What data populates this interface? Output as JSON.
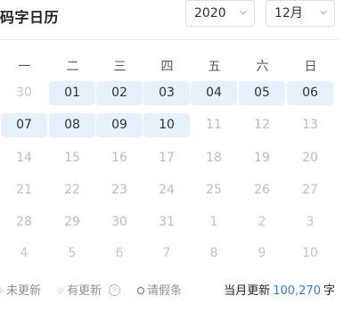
{
  "header": {
    "title": "码字日历",
    "year_value": "2020",
    "month_value": "12月"
  },
  "weekdays": [
    "一",
    "二",
    "三",
    "四",
    "五",
    "六",
    "日"
  ],
  "calendar": {
    "weeks": [
      [
        {
          "day": "30",
          "state": "other"
        },
        {
          "day": "01",
          "state": "updated"
        },
        {
          "day": "02",
          "state": "updated"
        },
        {
          "day": "03",
          "state": "updated"
        },
        {
          "day": "04",
          "state": "updated"
        },
        {
          "day": "05",
          "state": "updated"
        },
        {
          "day": "06",
          "state": "updated"
        }
      ],
      [
        {
          "day": "07",
          "state": "updated"
        },
        {
          "day": "08",
          "state": "updated"
        },
        {
          "day": "09",
          "state": "updated"
        },
        {
          "day": "10",
          "state": "updated"
        },
        {
          "day": "11",
          "state": "normal"
        },
        {
          "day": "12",
          "state": "normal"
        },
        {
          "day": "13",
          "state": "normal"
        }
      ],
      [
        {
          "day": "14",
          "state": "normal"
        },
        {
          "day": "15",
          "state": "normal"
        },
        {
          "day": "16",
          "state": "normal"
        },
        {
          "day": "17",
          "state": "normal"
        },
        {
          "day": "18",
          "state": "normal"
        },
        {
          "day": "19",
          "state": "normal"
        },
        {
          "day": "20",
          "state": "normal"
        }
      ],
      [
        {
          "day": "21",
          "state": "normal"
        },
        {
          "day": "22",
          "state": "normal"
        },
        {
          "day": "23",
          "state": "normal"
        },
        {
          "day": "24",
          "state": "normal"
        },
        {
          "day": "25",
          "state": "normal"
        },
        {
          "day": "26",
          "state": "normal"
        },
        {
          "day": "27",
          "state": "normal"
        }
      ],
      [
        {
          "day": "28",
          "state": "normal"
        },
        {
          "day": "29",
          "state": "normal"
        },
        {
          "day": "30",
          "state": "normal"
        },
        {
          "day": "31",
          "state": "normal"
        },
        {
          "day": "1",
          "state": "other"
        },
        {
          "day": "2",
          "state": "other"
        },
        {
          "day": "3",
          "state": "other"
        }
      ],
      [
        {
          "day": "4",
          "state": "other"
        },
        {
          "day": "5",
          "state": "other"
        },
        {
          "day": "6",
          "state": "other"
        },
        {
          "day": "7",
          "state": "other"
        },
        {
          "day": "8",
          "state": "other"
        },
        {
          "day": "9",
          "state": "other"
        },
        {
          "day": "10",
          "state": "other"
        }
      ]
    ]
  },
  "legend": {
    "not_updated": "未更新",
    "updated": "有更新",
    "help_icon": "question-icon",
    "leave": "请假条"
  },
  "summary": {
    "prefix": "当月更新",
    "count": "100,270",
    "unit": "字"
  },
  "colors": {
    "updated_bg": "#e7f1fd",
    "not_updated_dot": "#fde2e2",
    "updated_dot": "#e7f1fd",
    "leave_ring": "#3a7bd5",
    "accent": "#3a7bd5"
  }
}
